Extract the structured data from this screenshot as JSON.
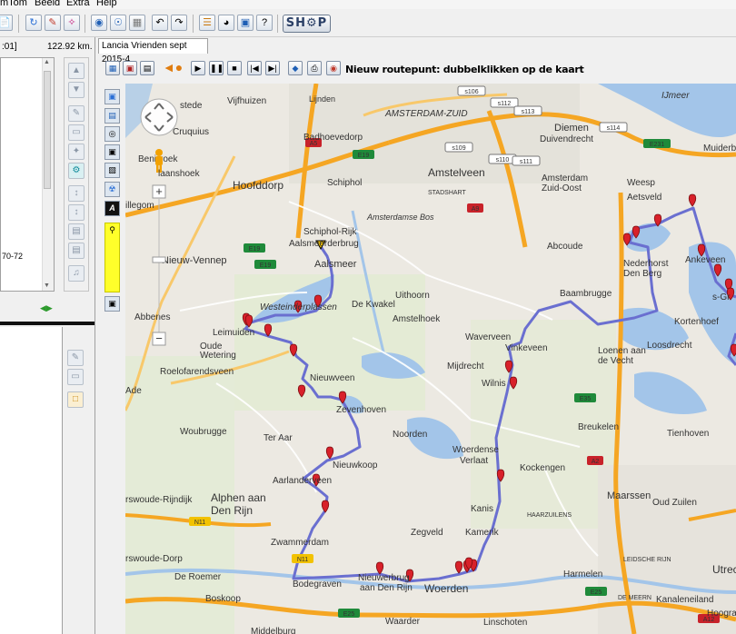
{
  "menubar": {
    "items": [
      "mTom",
      "Beeld",
      "Extra",
      "Help"
    ]
  },
  "toolbar": {
    "shop_label": "SH⚙P"
  },
  "left_panel": {
    "header_left": ":01]",
    "distance": "122.92 km.",
    "list_item": "70-72"
  },
  "tab": {
    "label": "Lancia Vrienden sept 2015-4"
  },
  "route_toolbar": {
    "hint": "Nieuw routepunt: dubbelklikken op de kaart"
  },
  "map": {
    "places": [
      {
        "text": "Lijnden"
      },
      {
        "text": "Vijfhuizen"
      },
      {
        "text": "stede"
      },
      {
        "text": "Cruquius"
      },
      {
        "text": "Badhoevedorp"
      },
      {
        "text": "AMSTERDAM-ZUID"
      },
      {
        "text": "Diemen"
      },
      {
        "text": "IJmeer"
      },
      {
        "text": "Duivendrecht"
      },
      {
        "text": "Muiderbe"
      },
      {
        "text": "Beni"
      },
      {
        "text": "roek"
      },
      {
        "text": "laanshoek"
      },
      {
        "text": "Hoofddorp"
      },
      {
        "text": "Schiphol"
      },
      {
        "text": "Amstelveen"
      },
      {
        "text": "Amsterdam"
      },
      {
        "text": "Zuid-Oost"
      },
      {
        "text": "Weesp"
      },
      {
        "text": "Aetsveld"
      },
      {
        "text": "illegom"
      },
      {
        "text": "STADSHART"
      },
      {
        "text": "Amsterdamse Bos"
      },
      {
        "text": "Schiphol-Rijk"
      },
      {
        "text": "Aalsmeerderbrug"
      },
      {
        "text": "Abcoude"
      },
      {
        "text": "Nieuw-Vennep"
      },
      {
        "text": "Aalsmeer"
      },
      {
        "text": "Nederhorst"
      },
      {
        "text": "Den Berg"
      },
      {
        "text": "Ankeveen"
      },
      {
        "text": "Westeinderplassen"
      },
      {
        "text": "Uithoorn"
      },
      {
        "text": "De Kwakel"
      },
      {
        "text": "Baambrugge"
      },
      {
        "text": "s-Gr"
      },
      {
        "text": "Abbenes"
      },
      {
        "text": "Amstelhoek"
      },
      {
        "text": "Kortenhoef"
      },
      {
        "text": "Leimuiden"
      },
      {
        "text": "Oude"
      },
      {
        "text": "Wetering"
      },
      {
        "text": "Waverveen"
      },
      {
        "text": "Vinkeveen"
      },
      {
        "text": "Loosdrecht"
      },
      {
        "text": "Loenen aan"
      },
      {
        "text": "de Vecht"
      },
      {
        "text": "Roelofarendsveen"
      },
      {
        "text": "Mijdrecht"
      },
      {
        "text": "Nieuwveen"
      },
      {
        "text": "Ade"
      },
      {
        "text": "Wilnis"
      },
      {
        "text": "Zevenhoven"
      },
      {
        "text": "Breukelen"
      },
      {
        "text": "Woubrugge"
      },
      {
        "text": "Tienhoven"
      },
      {
        "text": "Ter Aar"
      },
      {
        "text": "Noorden"
      },
      {
        "text": "Woerdense"
      },
      {
        "text": "Verlaat"
      },
      {
        "text": "Nieuwkoop"
      },
      {
        "text": "Kockengen"
      },
      {
        "text": "Aarlanderveen"
      },
      {
        "text": "rswoude-Rijndijk"
      },
      {
        "text": "Alphen aan"
      },
      {
        "text": "Den Rijn"
      },
      {
        "text": "Maarssen"
      },
      {
        "text": "Oud Zuilen"
      },
      {
        "text": "Kanis"
      },
      {
        "text": "HAARZUILENS"
      },
      {
        "text": "Zegveld"
      },
      {
        "text": "Kamerik"
      },
      {
        "text": "Zwammerdam"
      },
      {
        "text": "rswoude-Dorp"
      },
      {
        "text": "LEIDSCHE RIJN"
      },
      {
        "text": "De Roemer"
      },
      {
        "text": "Harmelen"
      },
      {
        "text": "Utrec"
      },
      {
        "text": "Bodegraven"
      },
      {
        "text": "Nieuwerbrug"
      },
      {
        "text": "aan Den Rijn"
      },
      {
        "text": "Woerden"
      },
      {
        "text": "Boskoop"
      },
      {
        "text": "DE MEERN"
      },
      {
        "text": "Kanaleneiland"
      },
      {
        "text": "Waarder"
      },
      {
        "text": "Linschoten"
      },
      {
        "text": "Hoogra"
      },
      {
        "text": "Middelburg"
      }
    ],
    "road_shields": [
      "s106",
      "s112",
      "s113",
      "s109",
      "s110",
      "s111",
      "s114",
      "A5",
      "E19",
      "A9",
      "E231",
      "E19",
      "E19",
      "E35",
      "A2",
      "N11",
      "N11",
      "E25",
      "E25",
      "A12"
    ],
    "zoom_in": "+",
    "zoom_out": "−"
  },
  "colors": {
    "route": "#6a6fd0",
    "marker": "#d8212a",
    "water": "#a3c5e9",
    "highway": "#f5a623"
  }
}
